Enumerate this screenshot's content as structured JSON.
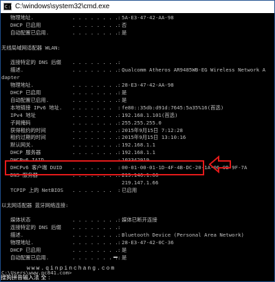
{
  "window": {
    "title": "C:\\windows\\system32\\cmd.exe",
    "icon_text": "C:\\"
  },
  "lines": [
    {
      "label": "物理地址.",
      "dots": ". . . . . . . .",
      "colon": ":",
      "value": "5A-E3-47-42-AA-98"
    },
    {
      "label": "DHCP 已启用",
      "dots": ". . . . . . . .",
      "colon": ":",
      "value": "否"
    },
    {
      "label": "自动配置已启用.",
      "dots": ". . . . . . . .",
      "colon": ":",
      "value": "是"
    },
    {
      "plain": "",
      "indent": 0
    },
    {
      "plain": "无线局域网适配器 WLAN:",
      "indent": 0
    },
    {
      "plain": "",
      "indent": 0
    },
    {
      "label": "连接特定的 DNS 后缀",
      "dots": ". . . . . . . .",
      "colon": ":",
      "value": ""
    },
    {
      "label": "描述.",
      "dots": ". . . . . . . . .",
      "colon": ":",
      "value": "Qualcomm Atheros AR9485WB-EG Wireless Network A"
    },
    {
      "plain": "dapter",
      "indent": 0
    },
    {
      "label": "物理地址.",
      "dots": ". . . . . . . .",
      "colon": ":",
      "value": "28-E3-47-42-AA-98"
    },
    {
      "label": "DHCP 已启用",
      "dots": ". . . . . . . .",
      "colon": ":",
      "value": "是"
    },
    {
      "label": "自动配置已启用.",
      "dots": ". . . . . . . .",
      "colon": ":",
      "value": "是"
    },
    {
      "label": "本地链接 IPv6 地址.",
      "dots": ". . . . . . .",
      "colon": ":",
      "value": "fe80::35db:d91d:7645:5a35%16(首选)"
    },
    {
      "label": "IPv4 地址",
      "dots": ". . . . . . . . .",
      "colon": ":",
      "value": "192.168.1.101(首选)"
    },
    {
      "label": "子网掩码",
      "dots": ". . . . . . . . .",
      "colon": ":",
      "value": "255.255.255.0"
    },
    {
      "label": "获得租约的时间",
      "dots": ". . . . . . . .",
      "colon": ":",
      "value": "2015年9月15日 7:12:28"
    },
    {
      "label": "租约过期的时间",
      "dots": ". . . . . . . .",
      "colon": ":",
      "value": "2015年9月15日 13:10:16"
    },
    {
      "label": "默认网关.",
      "dots": ". . . . . . . .",
      "colon": ":",
      "value": "192.168.1.1"
    },
    {
      "label": "DHCP 服务器",
      "dots": ". . . . . . . .",
      "colon": ":",
      "value": "192.168.1.1"
    },
    {
      "label": "DHCPv6 IAID",
      "dots": ". . . . . . . .",
      "colon": ":",
      "value": "103342919"
    },
    {
      "label": "DHCPv6 客户端 DUID",
      "dots": ". . . . . . .",
      "colon": ":",
      "value": "00-01-00-01-1D-4F-4B-DC-20-1A-06-9B-9F-7A"
    },
    {
      "label": "DNS 服务器",
      "dots": ". . . . . . . . .",
      "colon": ":",
      "value": "219.146.1.66"
    },
    {
      "label": "",
      "dots": "",
      "colon": "",
      "value": "219.147.1.66"
    },
    {
      "label": "TCPIP 上的 NetBIOS",
      "dots": ". . . . . . .",
      "colon": ":",
      "value": "已启用"
    },
    {
      "plain": "",
      "indent": 0
    },
    {
      "plain": "以太网适配器 蓝牙网络连接:",
      "indent": 0
    },
    {
      "plain": "",
      "indent": 0
    },
    {
      "label": "媒体状态",
      "dots": ". . . . . . . . .",
      "colon": ":",
      "value": "媒体已断开连接"
    },
    {
      "label": "连接特定的 DNS 后缀",
      "dots": ". . . . . . . .",
      "colon": ":",
      "value": ""
    },
    {
      "label": "描述.",
      "dots": ". . . . . . . . .",
      "colon": ":",
      "value": "Bluetooth Device (Personal Area Network)"
    },
    {
      "label": "物理地址.",
      "dots": ". . . . . . . .",
      "colon": ":",
      "value": "28-E3-47-42-0C-36"
    },
    {
      "label": "DHCP 已启用",
      "dots": ". . . . . . . .",
      "colon": ":",
      "value": "是"
    },
    {
      "label": "自动配置已启用.",
      "dots": ". . . . . . . .",
      "colon": ":",
      "value": "是"
    },
    {
      "plain": "",
      "indent": 0
    },
    {
      "plain": "C:\\Users\\www.pc841.com>",
      "indent": 0
    }
  ],
  "watermark": "www.qinpinchang.com",
  "ime": "搜狗拼音输入法 全 :",
  "highlight_color": "#e61a1a"
}
